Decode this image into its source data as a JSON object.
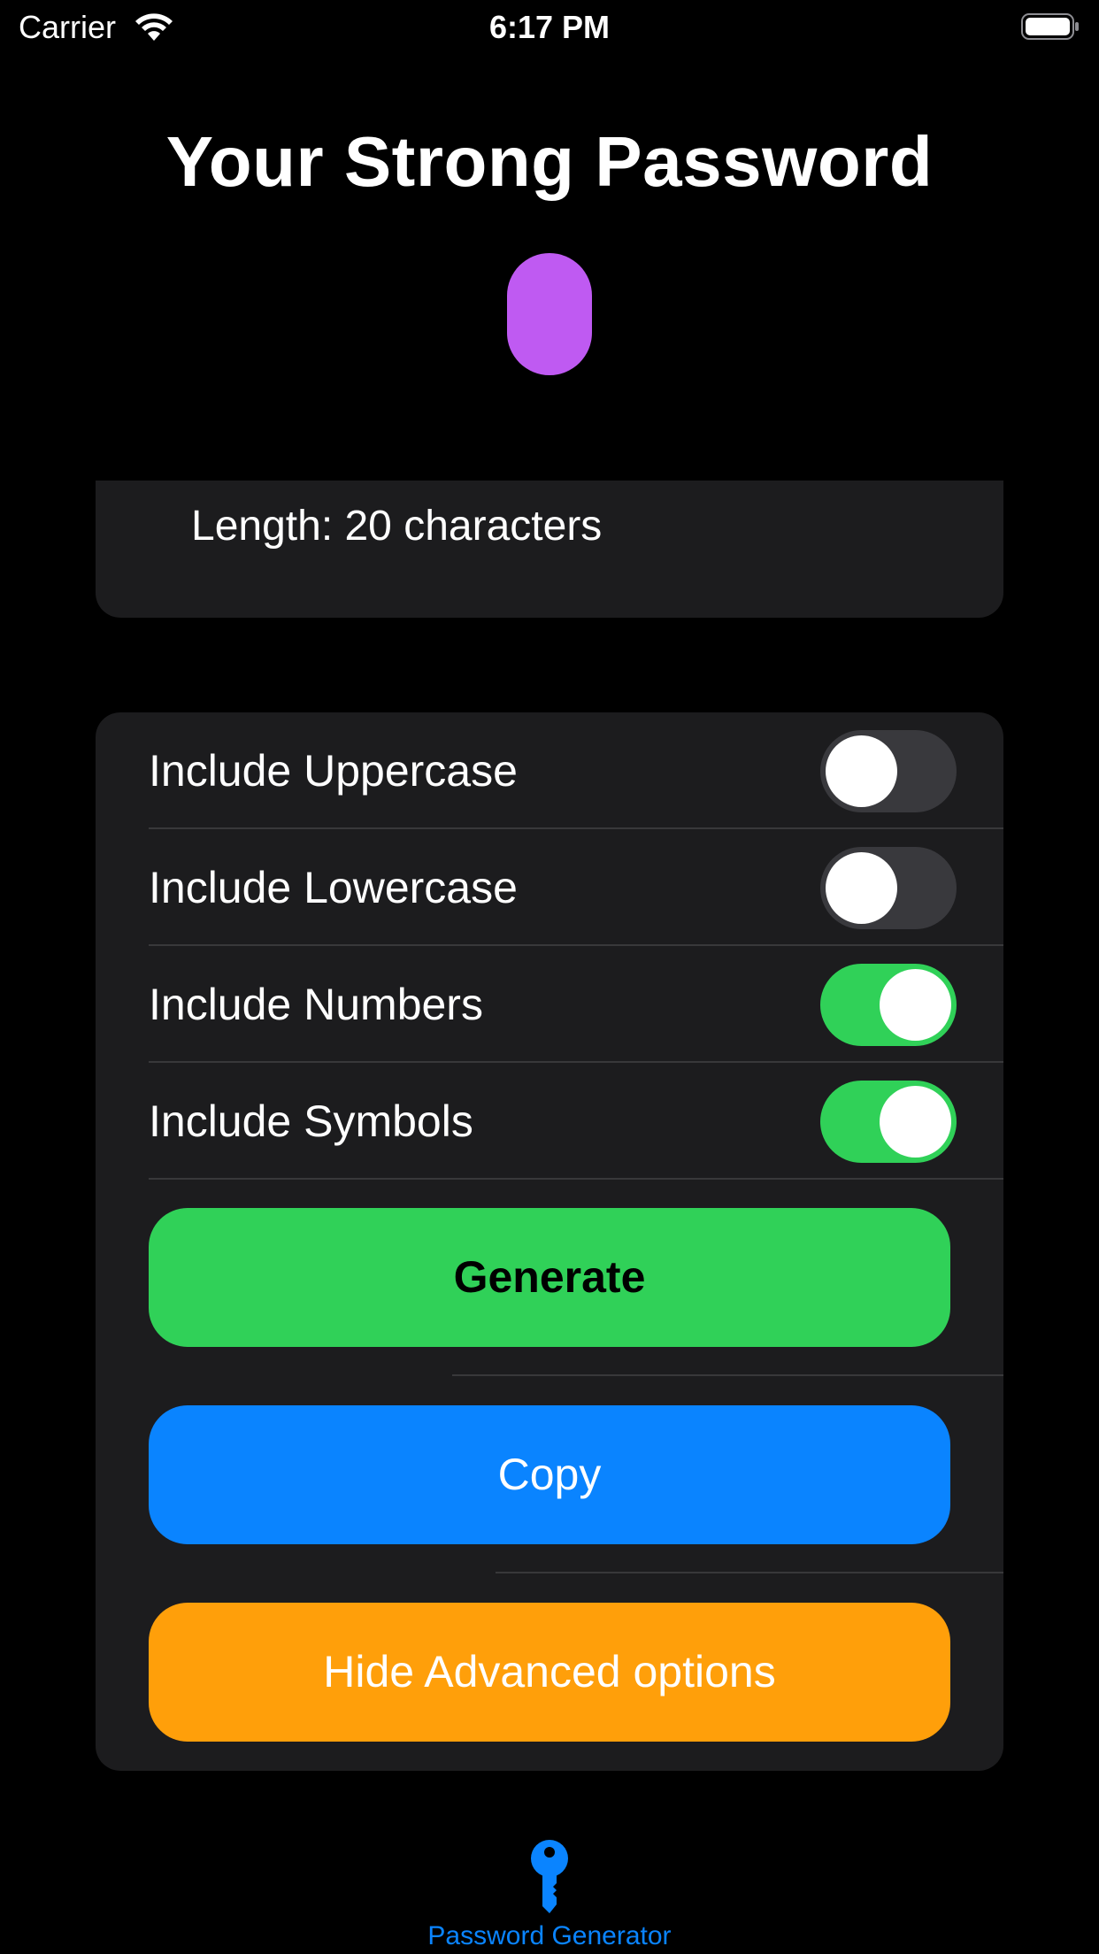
{
  "status_bar": {
    "carrier": "Carrier",
    "time": "6:17 PM"
  },
  "title": "Your Strong Password",
  "password": {
    "color": "#bf5af2"
  },
  "length": {
    "label": "Length: 20 characters"
  },
  "options": [
    {
      "label": "Include Uppercase",
      "enabled": false
    },
    {
      "label": "Include Lowercase",
      "enabled": false
    },
    {
      "label": "Include Numbers",
      "enabled": true
    },
    {
      "label": "Include Symbols",
      "enabled": true
    }
  ],
  "buttons": {
    "generate": "Generate",
    "copy": "Copy",
    "hide_advanced": "Hide Advanced options"
  },
  "tab_bar": {
    "items": [
      {
        "label": "Password Generator",
        "icon": "key-icon",
        "selected": true
      }
    ]
  },
  "colors": {
    "background": "#000000",
    "card": "#1c1c1e",
    "toggle_on": "#30d158",
    "toggle_off": "#39393d",
    "generate": "#30d158",
    "copy": "#0a84ff",
    "hide": "#ff9f0a",
    "tab_tint": "#0a84ff"
  }
}
